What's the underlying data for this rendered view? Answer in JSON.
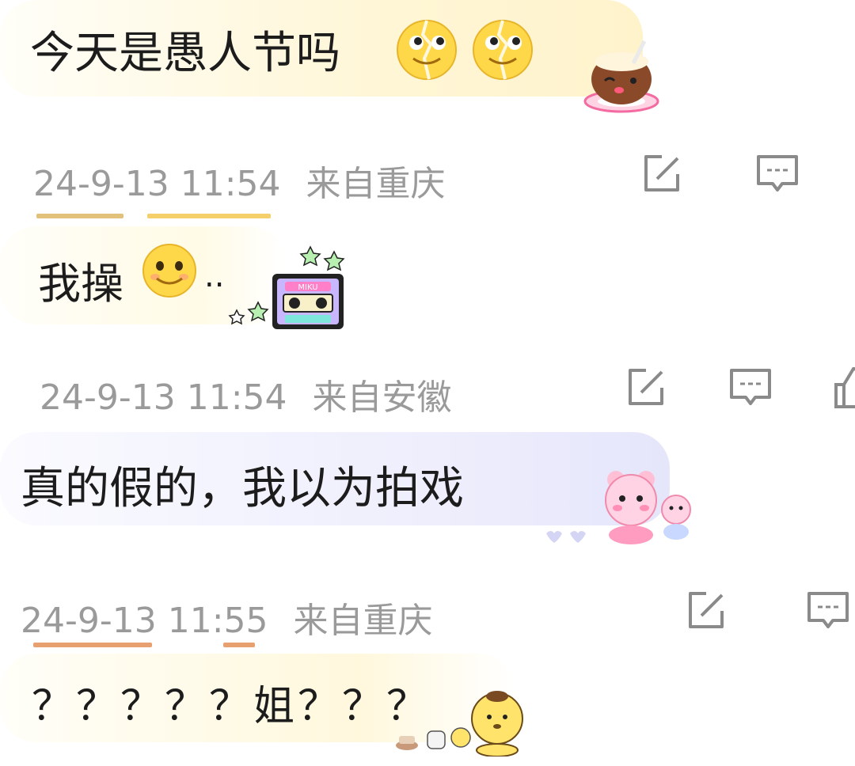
{
  "comments": [
    {
      "text": "今天是愚人节吗",
      "timestamp": "24-9-13 11:54",
      "location": "来自重庆"
    },
    {
      "text": "我操",
      "trailing": "..",
      "timestamp": "24-9-13 11:54",
      "location": "来自安徽"
    },
    {
      "text": "真的假的，我以为拍戏",
      "timestamp": "24-9-13 11:55",
      "location": "来自重庆"
    },
    {
      "text": "？？？？？姐？？？"
    }
  ],
  "sticker_text": {
    "cassette": "MIKU"
  },
  "icons": {
    "share": "share-icon",
    "comment": "comment-icon",
    "like": "thumbs-up-icon",
    "smile": "smile-emoji-icon",
    "cracked_smile": "cracked-smile-emoji-icon"
  },
  "colors": {
    "text": "#1c1c1c",
    "meta": "#9a9a9a",
    "bubble_1": "#fff6d8",
    "bubble_2": "#fffbe6",
    "bubble_3": "#eeeefc",
    "bubble_4": "#fff8dd"
  }
}
